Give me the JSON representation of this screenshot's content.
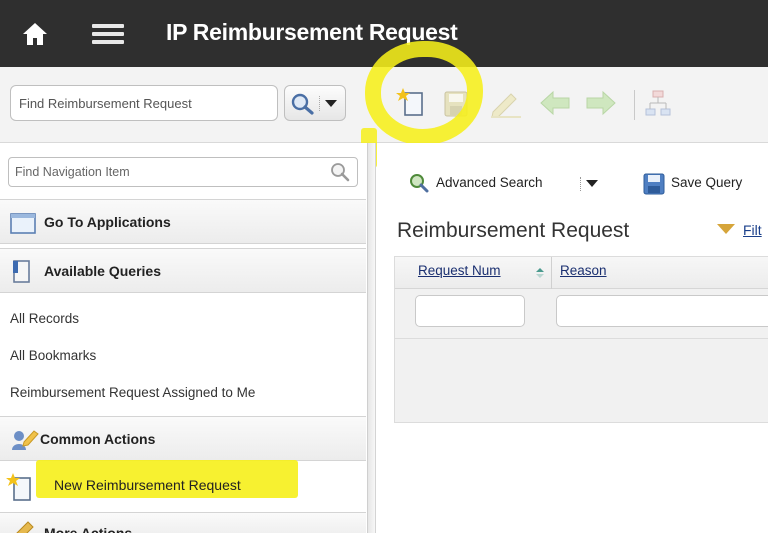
{
  "header": {
    "title": "IP Reimbursement Request",
    "home_icon": "home-icon",
    "menu_icon": "hamburger-menu-icon"
  },
  "toolbar": {
    "find_placeholder": "Find Reimbursement Request",
    "search_icon": "magnifier-icon",
    "icons": [
      "new-record-icon",
      "save-icon",
      "edit-icon",
      "back-arrow-icon",
      "forward-arrow-icon",
      "workflow-icon"
    ]
  },
  "nav": {
    "find_placeholder": "Find Navigation Item",
    "sections": [
      {
        "label": "Go To Applications",
        "icon": "applications-icon"
      },
      {
        "label": "Available Queries",
        "icon": "queries-icon"
      },
      {
        "label": "Common Actions",
        "icon": "common-actions-icon"
      },
      {
        "label": "More Actions",
        "icon": "more-actions-icon"
      }
    ],
    "query_links": [
      "All Records",
      "All Bookmarks",
      "Reimbursement Request Assigned to Me"
    ],
    "actions": [
      {
        "label": "New Reimbursement Request",
        "icon": "new-record-icon"
      }
    ]
  },
  "main": {
    "advanced_search_label": "Advanced Search",
    "save_query_label": "Save Query",
    "title": "Reimbursement Request",
    "filter_label": "Filt",
    "columns": [
      {
        "label": "Request Num",
        "sorted": true
      },
      {
        "label": "Reason",
        "sorted": false
      }
    ]
  },
  "colors": {
    "header_bg": "#2f2f2f",
    "highlight": "#f6ef1a",
    "link": "#1a2f70"
  }
}
